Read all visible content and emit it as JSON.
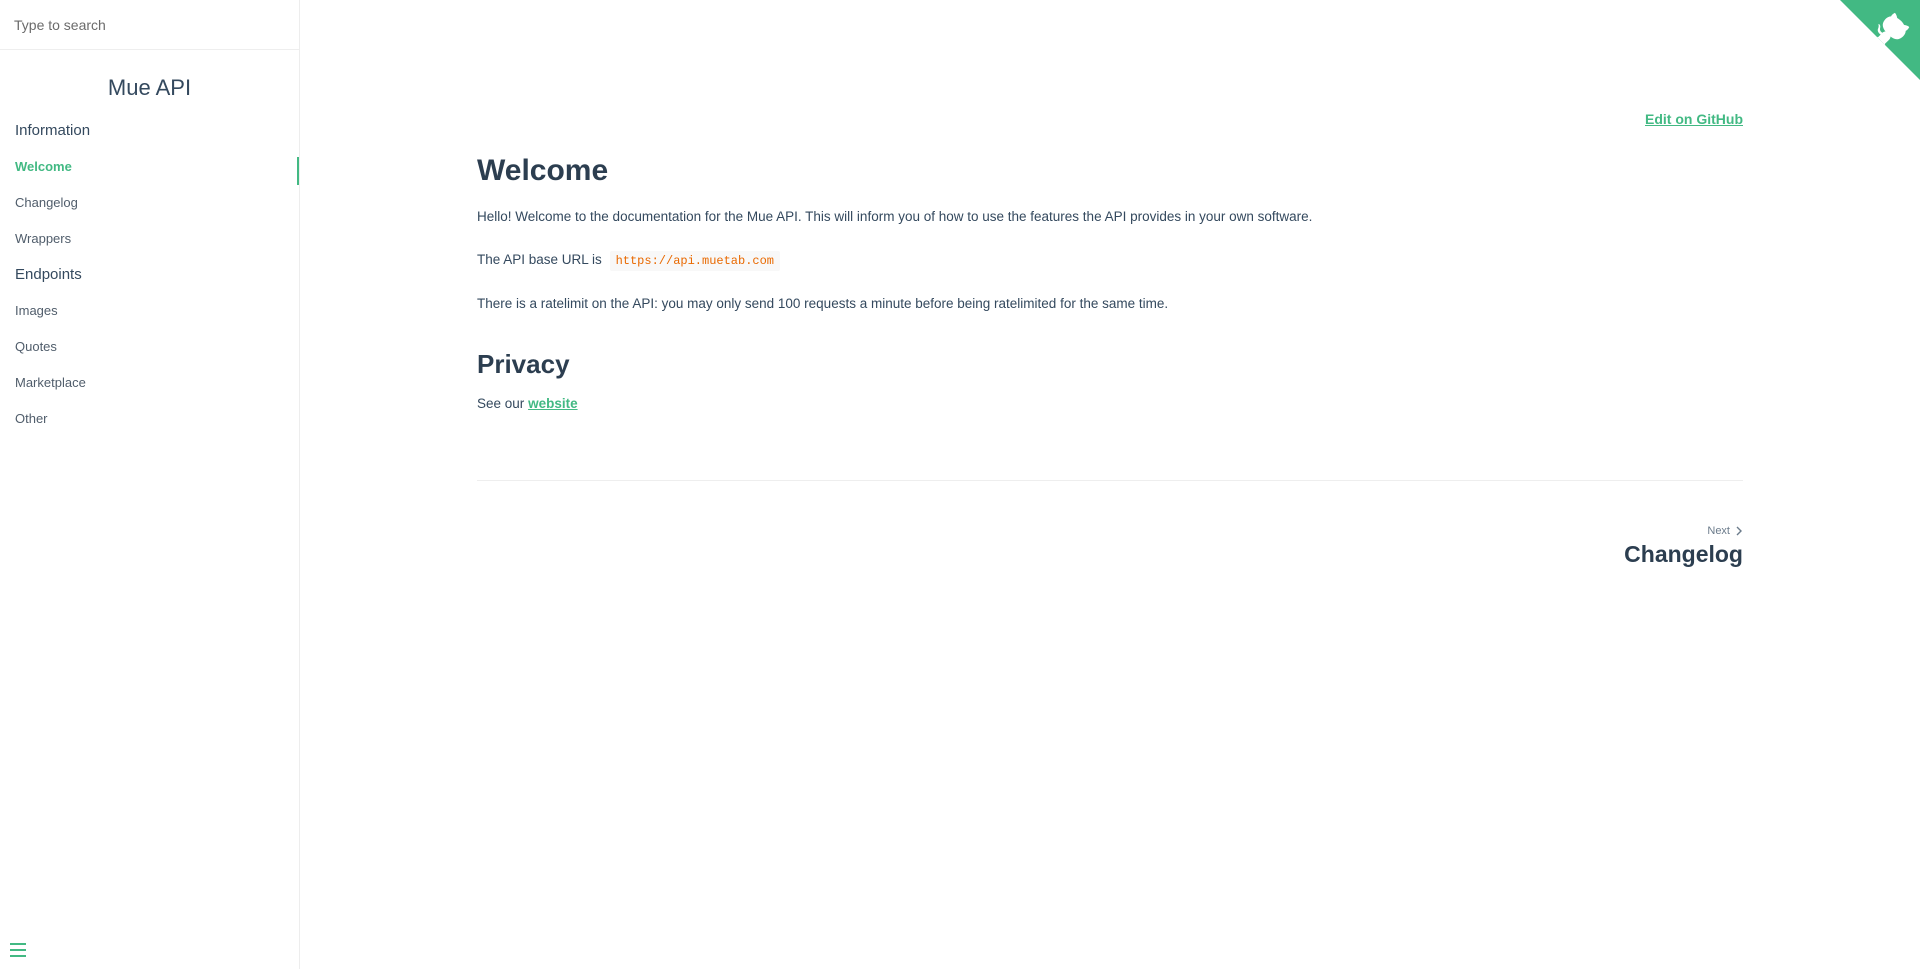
{
  "search": {
    "placeholder": "Type to search"
  },
  "app": {
    "name": "Mue API"
  },
  "sidebar": {
    "sections": [
      {
        "title": "Information",
        "items": [
          "Welcome",
          "Changelog",
          "Wrappers"
        ]
      },
      {
        "title": "Endpoints",
        "items": [
          "Images",
          "Quotes",
          "Marketplace",
          "Other"
        ]
      }
    ],
    "active": "Welcome"
  },
  "toolbar": {
    "edit_label": "Edit on GitHub"
  },
  "main": {
    "title": "Welcome",
    "intro": "Hello! Welcome to the documentation for the Mue API. This will inform you of how to use the features the API provides in your own software.",
    "base_url_text": "The API base URL is",
    "base_url": "https://api.muetab.com",
    "ratelimit": "There is a ratelimit on the API: you may only send 100 requests a minute before being ratelimited for the same time.",
    "privacy_title": "Privacy",
    "privacy_text": "See our",
    "privacy_link": "website"
  },
  "pager": {
    "next_label": "Next",
    "next_title": "Changelog"
  },
  "colors": {
    "accent": "#42b983",
    "heading": "#2c3e50",
    "text": "#34495e",
    "code": "#e96900"
  },
  "icons": {
    "corner": "github-octocat-icon",
    "toggle": "hamburger-menu-icon",
    "next": "chevron-right-icon"
  }
}
